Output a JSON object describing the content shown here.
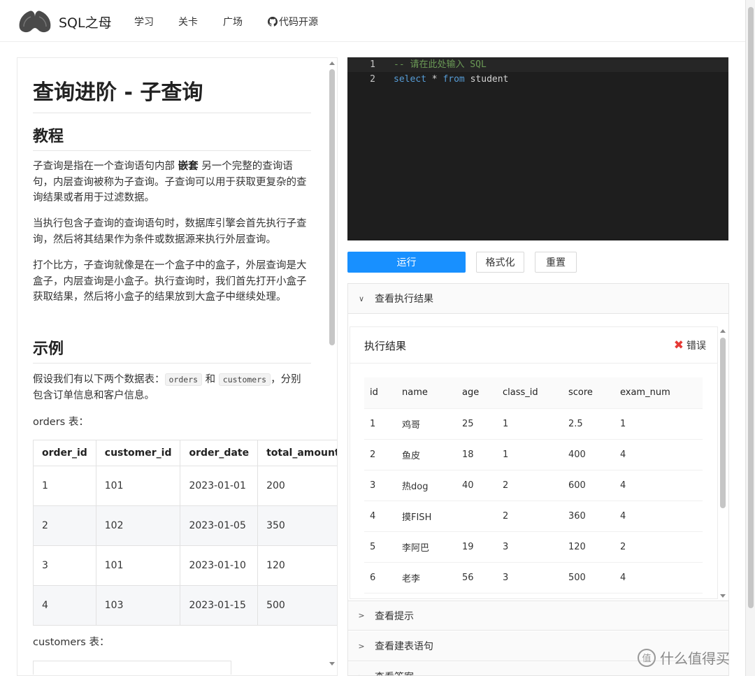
{
  "header": {
    "brand": "SQL之母",
    "nav": [
      "学习",
      "关卡",
      "广场",
      "代码开源"
    ]
  },
  "lesson": {
    "title": "查询进阶 - 子查询",
    "tutorial_heading": "教程",
    "p1_a": "子查询是指在一个查询语句内部 ",
    "p1_bold": "嵌套",
    "p1_b": " 另一个完整的查询语句，内层查询被称为子查询。子查询可以用于获取更复杂的查询结果或者用于过滤数据。",
    "p2": "当执行包含子查询的查询语句时，数据库引擎会首先执行子查询，然后将其结果作为条件或数据源来执行外层查询。",
    "p3": "打个比方，子查询就像是在一个盒子中的盒子，外层查询是大盒子，内层查询是小盒子。执行查询时，我们首先打开小盒子获取结果，然后将小盒子的结果放到大盒子中继续处理。",
    "example_heading": "示例",
    "p4_a": "假设我们有以下两个数据表：",
    "p4_code1": "orders",
    "p4_mid": " 和 ",
    "p4_code2": "customers",
    "p4_b": "，分别包含订单信息和客户信息。",
    "orders_caption": "orders 表：",
    "orders_table": {
      "columns": [
        "order_id",
        "customer_id",
        "order_date",
        "total_amount"
      ],
      "rows": [
        [
          "1",
          "101",
          "2023-01-01",
          "200"
        ],
        [
          "2",
          "102",
          "2023-01-05",
          "350"
        ],
        [
          "3",
          "101",
          "2023-01-10",
          "120"
        ],
        [
          "4",
          "103",
          "2023-01-15",
          "500"
        ]
      ]
    },
    "customers_caption": "customers 表："
  },
  "editor": {
    "line1_no": "1",
    "line1": "-- 请在此处输入 SQL",
    "line2_no": "2",
    "line2_kw1": "select",
    "line2_op": " * ",
    "line2_kw2": "from",
    "line2_id": " student"
  },
  "buttons": {
    "run": "运行",
    "format": "格式化",
    "reset": "重置"
  },
  "result_panel": {
    "header": "查看执行结果",
    "title": "执行结果",
    "status": "错误",
    "columns": [
      "id",
      "name",
      "age",
      "class_id",
      "score",
      "exam_num"
    ],
    "rows": [
      [
        "1",
        "鸡哥",
        "25",
        "1",
        "2.5",
        "1"
      ],
      [
        "2",
        "鱼皮",
        "18",
        "1",
        "400",
        "4"
      ],
      [
        "3",
        "热dog",
        "40",
        "2",
        "600",
        "4"
      ],
      [
        "4",
        "摸FISH",
        "",
        "2",
        "360",
        "4"
      ],
      [
        "5",
        "李阿巴",
        "19",
        "3",
        "120",
        "2"
      ],
      [
        "6",
        "老李",
        "56",
        "3",
        "500",
        "4"
      ]
    ]
  },
  "collapse": {
    "hint": "查看提示",
    "ddl": "查看建表语句",
    "answer": "查看答案"
  },
  "watermark": "什么值得买",
  "colors": {
    "accent": "#1890ff",
    "error": "#e53935",
    "editor_bg": "#1e1e1e"
  }
}
